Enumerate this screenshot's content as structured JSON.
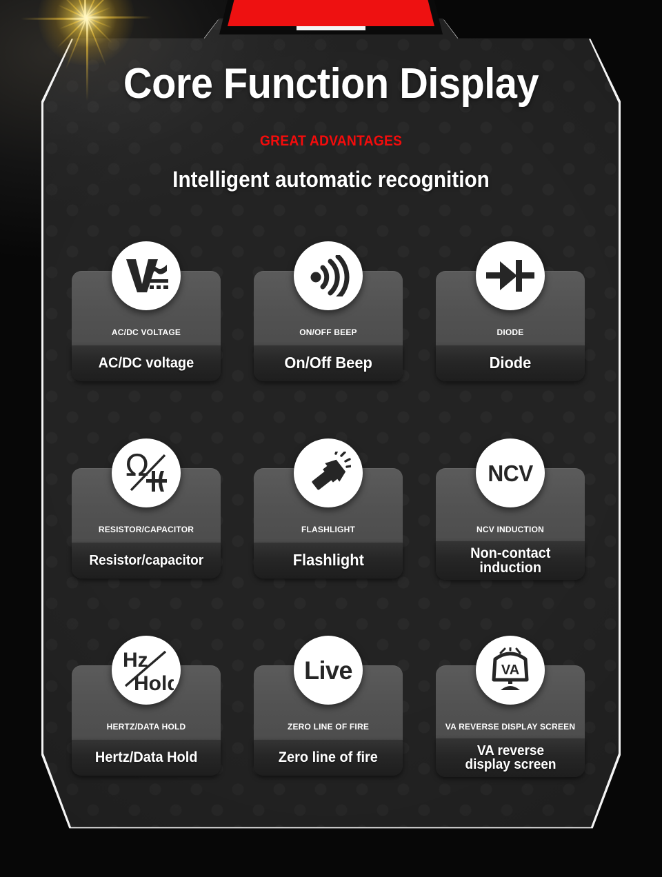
{
  "header": {
    "title": "Core Function Display",
    "subtitle": "GREAT ADVANTAGES",
    "tagline": "Intelligent automatic recognition"
  },
  "colors": {
    "accent_red": "#f40c0c",
    "banner_red": "#ee1111",
    "frame_white": "#f4f4f4",
    "card_gray": "#525252",
    "labelbar_dark": "#262626",
    "page_background": "#232323",
    "text_white": "#ffffff",
    "flare_gold": "#ffd640"
  },
  "features": [
    {
      "icon": "ac-dc-voltage-icon",
      "caption": "AC/DC VOLTAGE",
      "label": "AC/DC voltage",
      "label_lines": 1
    },
    {
      "icon": "sound-wave-beep-icon",
      "caption": "ON/OFF BEEP",
      "label": "On/Off Beep",
      "label_lines": 1
    },
    {
      "icon": "diode-icon",
      "caption": "DIODE",
      "label": "Diode",
      "label_lines": 1
    },
    {
      "icon": "resistor-capacitor-icon",
      "caption": "RESISTOR/CAPACITOR",
      "label": "Resistor/capacitor",
      "label_lines": 1
    },
    {
      "icon": "flashlight-icon",
      "caption": "FLASHLIGHT",
      "label": "Flashlight",
      "label_lines": 1
    },
    {
      "icon": "ncv-text-icon",
      "caption": "NCV INDUCTION",
      "label": "Non-contact\ninduction",
      "label_lines": 2
    },
    {
      "icon": "hertz-data-hold-icon",
      "caption": "HERTZ/DATA HOLD",
      "label": "Hertz/Data Hold",
      "label_lines": 1
    },
    {
      "icon": "live-text-icon",
      "caption": "ZERO LINE OF FIRE",
      "label": "Zero line of fire",
      "label_lines": 1
    },
    {
      "icon": "va-reverse-screen-icon",
      "caption": "VA REVERSE DISPLAY SCREEN",
      "label": "VA reverse\ndisplay screen",
      "label_lines": 2
    }
  ],
  "icon_glyph_text": {
    "ncv": "NCV",
    "live": "Live",
    "hz": "Hz",
    "hold": "Hold",
    "va": "VA"
  }
}
